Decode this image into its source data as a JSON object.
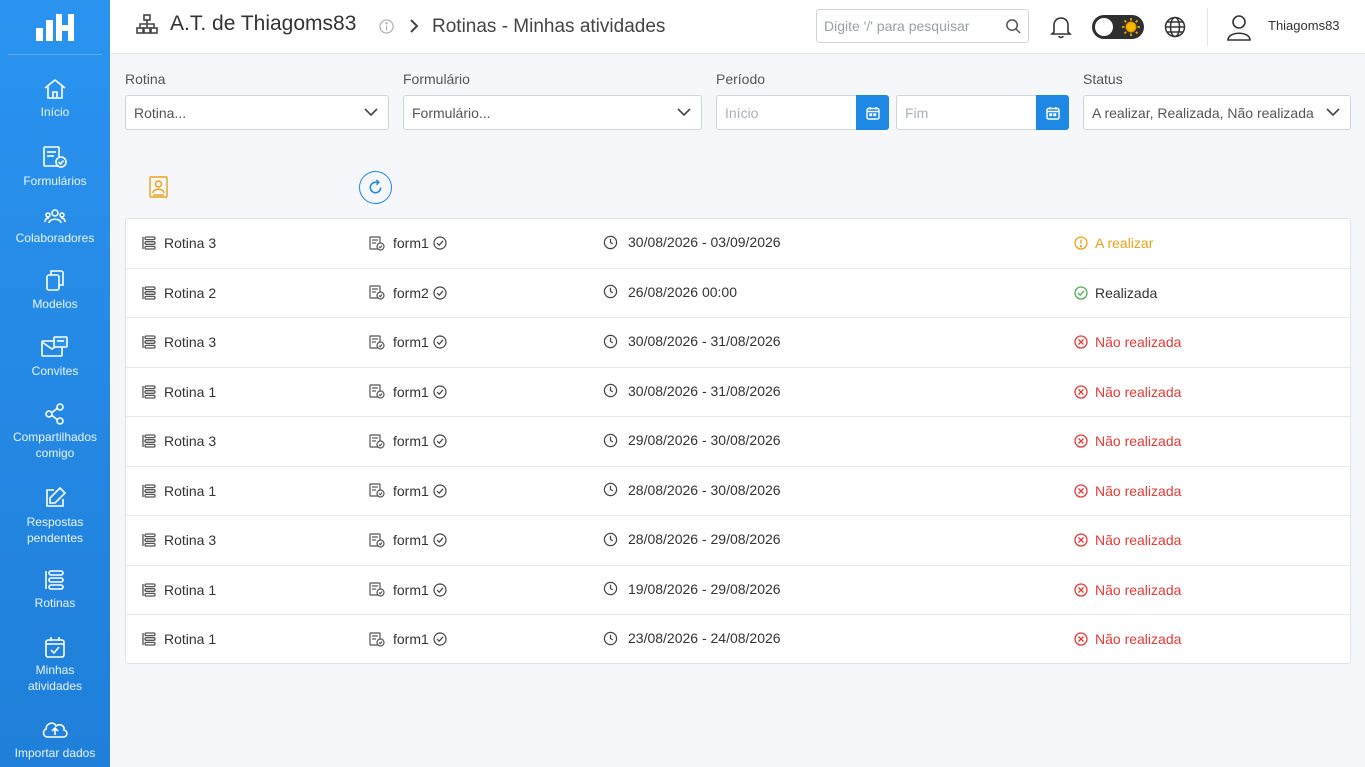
{
  "header": {
    "org_name": "A.T. de Thiagoms83",
    "page_title": "Rotinas - Minhas atividades",
    "search_placeholder": "Digite '/' para pesquisar",
    "username": "Thiagoms83"
  },
  "sidebar": {
    "items": [
      {
        "label": "Início",
        "icon": "home-icon"
      },
      {
        "label": "Formulários",
        "icon": "forms-icon"
      },
      {
        "label": "Colaboradores",
        "icon": "users-icon"
      },
      {
        "label": "Modelos",
        "icon": "copy-icon"
      },
      {
        "label": "Convites",
        "icon": "invite-icon"
      },
      {
        "label": "Compartilhados comigo",
        "icon": "share-icon"
      },
      {
        "label": "Respostas pendentes",
        "icon": "edit-icon"
      },
      {
        "label": "Rotinas",
        "icon": "list-icon"
      },
      {
        "label": "Minhas atividades",
        "icon": "calendar-check-icon"
      },
      {
        "label": "Importar dados",
        "icon": "cloud-upload-icon"
      }
    ]
  },
  "filters": {
    "rotina": {
      "label": "Rotina",
      "value": "Rotina..."
    },
    "formulario": {
      "label": "Formulário",
      "value": "Formulário..."
    },
    "periodo": {
      "label": "Período",
      "start_placeholder": "Início",
      "end_placeholder": "Fim"
    },
    "status": {
      "label": "Status",
      "value": "A realizar, Realizada, Não realizada"
    }
  },
  "colors": {
    "primary": "#1e88e5",
    "sidebar": "#2a93f0",
    "pending": "#e8a317",
    "done": "#4caf50",
    "missed": "#e53935"
  },
  "activities": [
    {
      "rotina": "Rotina 3",
      "form": "form1",
      "period": "30/08/2026 - 03/09/2026",
      "status": "A realizar",
      "status_type": "pending"
    },
    {
      "rotina": "Rotina 2",
      "form": "form2",
      "period": "26/08/2026 00:00",
      "status": "Realizada",
      "status_type": "done"
    },
    {
      "rotina": "Rotina 3",
      "form": "form1",
      "period": "30/08/2026 - 31/08/2026",
      "status": "Não realizada",
      "status_type": "missed"
    },
    {
      "rotina": "Rotina 1",
      "form": "form1",
      "period": "30/08/2026 - 31/08/2026",
      "status": "Não realizada",
      "status_type": "missed"
    },
    {
      "rotina": "Rotina 3",
      "form": "form1",
      "period": "29/08/2026 - 30/08/2026",
      "status": "Não realizada",
      "status_type": "missed"
    },
    {
      "rotina": "Rotina 1",
      "form": "form1",
      "period": "28/08/2026 - 30/08/2026",
      "status": "Não realizada",
      "status_type": "missed"
    },
    {
      "rotina": "Rotina 3",
      "form": "form1",
      "period": "28/08/2026 - 29/08/2026",
      "status": "Não realizada",
      "status_type": "missed"
    },
    {
      "rotina": "Rotina 1",
      "form": "form1",
      "period": "19/08/2026 - 29/08/2026",
      "status": "Não realizada",
      "status_type": "missed"
    },
    {
      "rotina": "Rotina 1",
      "form": "form1",
      "period": "23/08/2026 - 24/08/2026",
      "status": "Não realizada",
      "status_type": "missed"
    }
  ]
}
